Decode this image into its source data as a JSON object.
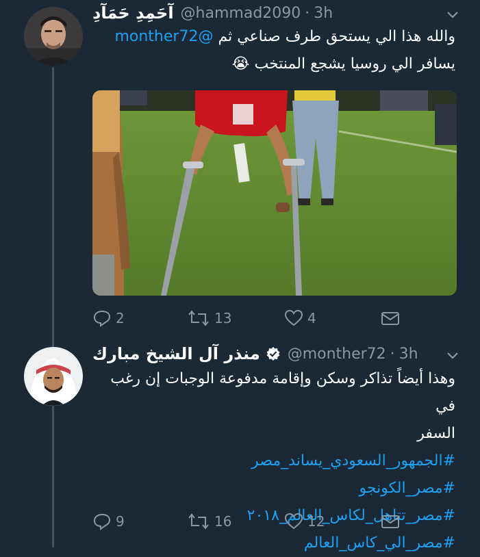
{
  "tweet1": {
    "name": "آحَمِدِ حَمَآدِ",
    "handle": "@hammad2090",
    "time": "3h",
    "line1_mention": "@monther72",
    "line1_text": "والله هذا الي يستحق طرف صناعي ثم",
    "line2_text": "يسافر الي روسيا يشجع المنتخب 😭",
    "replies": "2",
    "retweets": "13",
    "likes": "4"
  },
  "tweet2": {
    "name": "منذر آل الشيخ مبارك",
    "handle": "@monther72",
    "time": "3h",
    "line1": "وهذا أيضاً تذاكر وسكن وإقامة مدفوعة الوجبات إن رغب في",
    "line2": "السفر",
    "hashtags": [
      "#الجمهور_السعودي_يساند_مصر",
      "#مصر_الكونجو",
      "#مصر_تتاهل_لكاس_العالم_٢٠١٨",
      "#مصر_الي_كاس_العالم"
    ],
    "replies": "9",
    "retweets": "16",
    "likes": "12"
  },
  "icons": {
    "reply": "reply-icon",
    "retweet": "retweet-icon",
    "like": "heart-icon",
    "dm": "envelope-icon",
    "menu": "chevron-down-icon",
    "verified": "verified-badge-icon"
  },
  "colors": {
    "background": "#1b2836",
    "link": "#1da1f2",
    "muted": "#8899a6"
  }
}
